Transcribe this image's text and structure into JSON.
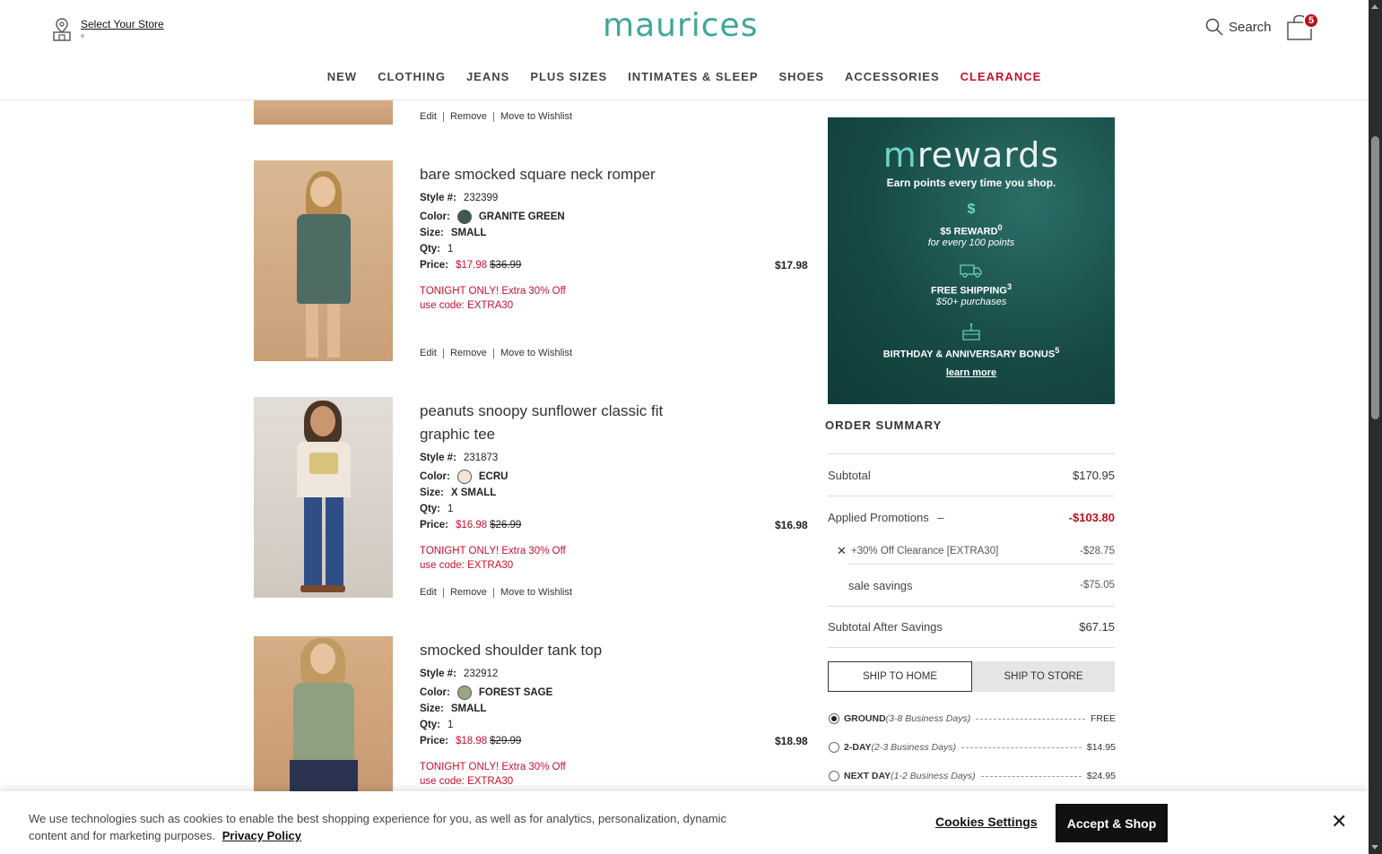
{
  "header": {
    "store_link": "Select Your Store",
    "logo": "maurices",
    "search_label": "Search",
    "cart_count": "5"
  },
  "nav": [
    "NEW",
    "CLOTHING",
    "JEANS",
    "PLUS SIZES",
    "INTIMATES & SLEEP",
    "SHOES",
    "ACCESSORIES",
    "CLEARANCE"
  ],
  "item_labels": {
    "style": "Style #:",
    "color": "Color:",
    "size": "Size:",
    "qty": "Qty:",
    "price": "Price:",
    "edit": "Edit",
    "remove": "Remove",
    "wishlist": "Move to Wishlist"
  },
  "items": [
    {
      "name": "bare smocked square neck romper",
      "style": "232399",
      "color": "GRANITE GREEN",
      "swatch": "#3f5a55",
      "size": "SMALL",
      "qty": "1",
      "sale_price": "$17.98",
      "orig_price": "$36.99",
      "total": "$17.98",
      "promo_line1": "TONIGHT ONLY! Extra 30% Off",
      "promo_line2": "use code: EXTRA30"
    },
    {
      "name": "peanuts snoopy sunflower classic fit graphic tee",
      "style": "231873",
      "color": "ECRU",
      "swatch": "#f2e6d8",
      "size": "X SMALL",
      "qty": "1",
      "sale_price": "$16.98",
      "orig_price": "$26.99",
      "total": "$16.98",
      "promo_line1": "TONIGHT ONLY! Extra 30% Off",
      "promo_line2": "use code: EXTRA30"
    },
    {
      "name": "smocked shoulder tank top",
      "style": "232912",
      "color": "FOREST SAGE",
      "swatch": "#9aa882",
      "size": "SMALL",
      "qty": "1",
      "sale_price": "$18.98",
      "orig_price": "$29.99",
      "total": "$18.98",
      "promo_line1": "TONIGHT ONLY! Extra 30% Off",
      "promo_line2": "use code: EXTRA30"
    }
  ],
  "rewards": {
    "title_m": "m",
    "title_rest": "rewards",
    "tagline": "Earn points every time you shop.",
    "reward_title": "$5 REWARD",
    "reward_sup": "0",
    "reward_sub": "for every 100 points",
    "ship_title": "FREE SHIPPING",
    "ship_sup": "3",
    "ship_sub": "$50+ purchases",
    "bday_title": "BIRTHDAY & ANNIVERSARY BONUS",
    "bday_sup": "5",
    "learn_more": "learn more"
  },
  "summary": {
    "title": "ORDER SUMMARY",
    "subtotal_label": "Subtotal",
    "subtotal": "$170.95",
    "promos_label": "Applied Promotions",
    "promos_toggle": "–",
    "promos_total": "-$103.80",
    "promo_code_label": "+30% Off Clearance [EXTRA30]",
    "promo_code_value": "-$28.75",
    "sale_savings_label": "sale savings",
    "sale_savings_value": "-$75.05",
    "after_label": "Subtotal After Savings",
    "after_value": "$67.15"
  },
  "shipping": {
    "tab_home": "SHIP TO HOME",
    "tab_store": "SHIP TO STORE",
    "options": [
      {
        "name": "GROUND",
        "days": "(3-8 Business Days)",
        "price": "FREE",
        "selected": true
      },
      {
        "name": "2-DAY",
        "days": "(2-3 Business Days)",
        "price": "$14.95",
        "selected": false
      },
      {
        "name": "NEXT DAY",
        "days": "(1-2 Business Days)",
        "price": "$24.95",
        "selected": false
      }
    ]
  },
  "cookie": {
    "text": "We use technologies such as cookies to enable the best shopping experience for you, as well as for analytics, personalization, dynamic content and for marketing purposes.",
    "policy_link": "Privacy Policy",
    "settings": "Cookies Settings",
    "accept": "Accept & Shop",
    "close": "✕"
  }
}
